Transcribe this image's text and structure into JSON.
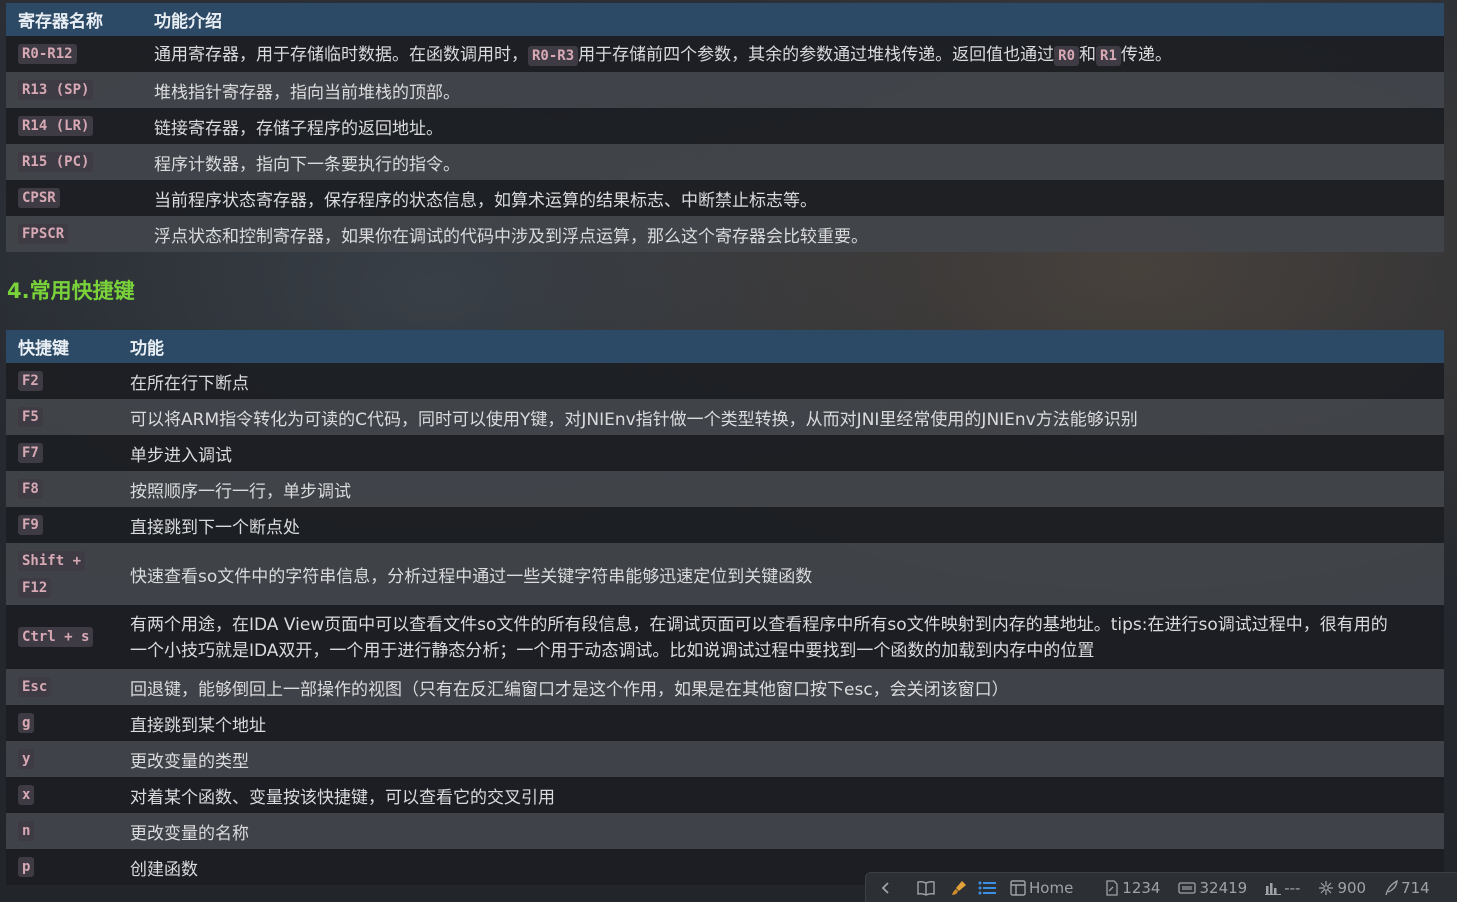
{
  "register_table": {
    "headers": [
      "寄存器名称",
      "功能介绍"
    ],
    "rows": [
      {
        "name": "R0-R12",
        "desc_parts": [
          "通用寄存器，用于存储临时数据。在函数调用时，",
          "R0-R3",
          "用于存储前四个参数，其余的参数通过堆栈传递。返回值也通过",
          "R0",
          "和",
          "R1",
          "传递。"
        ]
      },
      {
        "name": "R13 (SP)",
        "desc": "堆栈指针寄存器，指向当前堆栈的顶部。"
      },
      {
        "name": "R14 (LR)",
        "desc": "链接寄存器，存储子程序的返回地址。"
      },
      {
        "name": "R15 (PC)",
        "desc": "程序计数器，指向下一条要执行的指令。"
      },
      {
        "name": "CPSR",
        "desc": "当前程序状态寄存器，保存程序的状态信息，如算术运算的结果标志、中断禁止标志等。"
      },
      {
        "name": "FPSCR",
        "desc": "浮点状态和控制寄存器，如果你在调试的代码中涉及到浮点运算，那么这个寄存器会比较重要。"
      }
    ]
  },
  "section_heading": "4.常用快捷键",
  "shortcut_table": {
    "headers": [
      "快捷键",
      "功能"
    ],
    "rows": [
      {
        "key": "F2",
        "desc": "在所在行下断点"
      },
      {
        "key": "F5",
        "desc": "可以将ARM指令转化为可读的C代码，同时可以使用Y键，对JNIEnv指针做一个类型转换，从而对JNI里经常使用的JNIEnv方法能够识别"
      },
      {
        "key": "F7",
        "desc": "单步进入调试"
      },
      {
        "key": "F8",
        "desc": "按照顺序一行一行，单步调试"
      },
      {
        "key": "F9",
        "desc": "直接跳到下一个断点处"
      },
      {
        "key_line1": "Shift +",
        "key_line2": "F12",
        "desc": "快速查看so文件中的字符串信息，分析过程中通过一些关键字符串能够迅速定位到关键函数"
      },
      {
        "key": "Ctrl + s",
        "desc_line1": "有两个用途，在IDA View页面中可以查看文件so文件的所有段信息，在调试页面可以查看程序中所有so文件映射到内存的基地址。tips:在进行so调试过程中，很有用的",
        "desc_line2": "一个小技巧就是IDA双开，一个用于进行静态分析；一个用于动态调试。比如说调试过程中要找到一个函数的加载到内存中的位置"
      },
      {
        "key": "Esc",
        "desc": "回退键，能够倒回上一部操作的视图（只有在反汇编窗口才是这个作用，如果是在其他窗口按下esc，会关闭该窗口）"
      },
      {
        "key": "g",
        "desc": "直接跳到某个地址"
      },
      {
        "key": "y",
        "desc": "更改变量的类型"
      },
      {
        "key": "x",
        "desc": "对着某个函数、变量按该快捷键，可以查看它的交叉引用"
      },
      {
        "key": "n",
        "desc": "更改变量的名称"
      },
      {
        "key": "p",
        "desc": "创建函数"
      }
    ]
  },
  "status_bar": {
    "home_label": "Home",
    "lines": "1234",
    "words": "32419",
    "chart": "---",
    "nodes": "900",
    "links": "714"
  },
  "colors": {
    "header_bg": "#2c4a66",
    "heading_green": "#7ad23a",
    "code_text": "#d7a9b4",
    "accent_blue": "#3b8fe0",
    "brush_orange": "#e2a13a"
  }
}
